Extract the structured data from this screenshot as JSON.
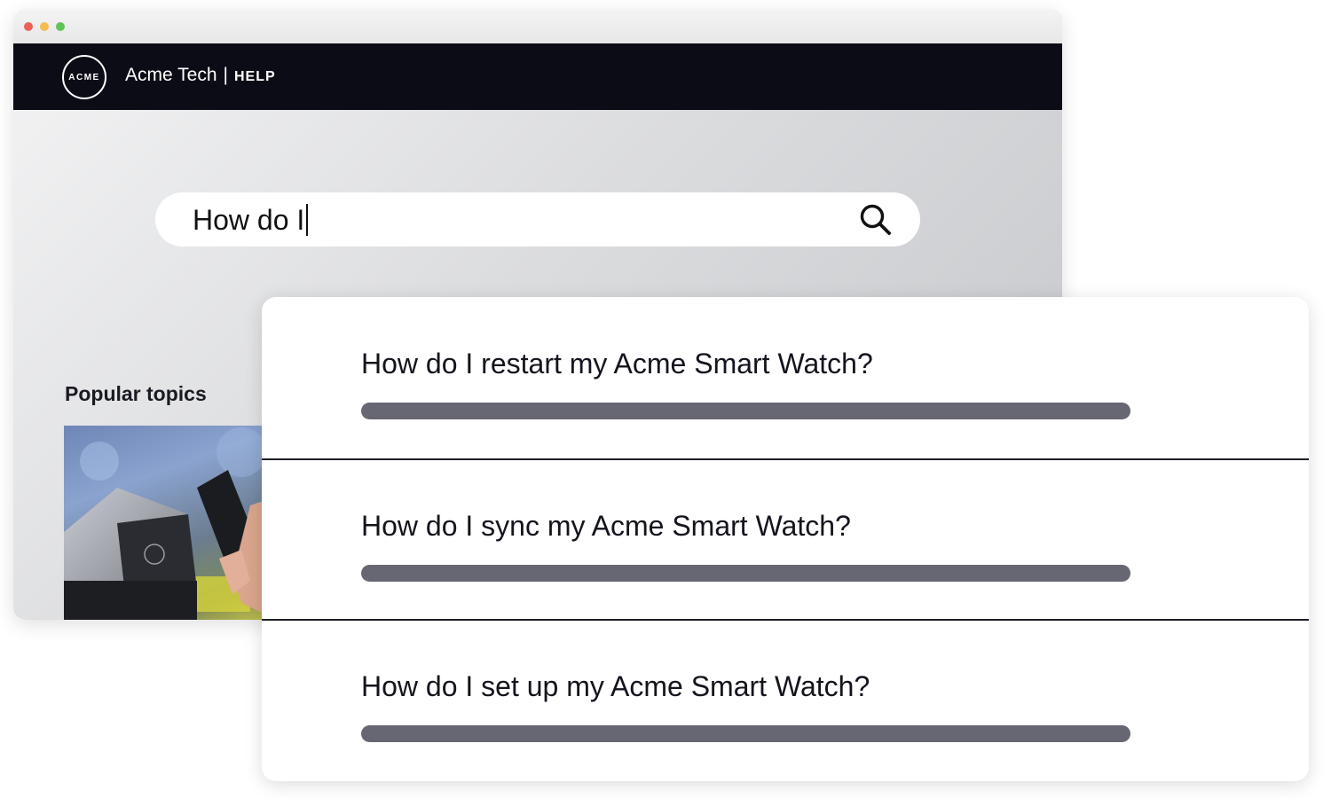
{
  "header": {
    "logo_text": "ACME",
    "brand_name": "Acme Tech",
    "separator": "|",
    "section": "HELP"
  },
  "search": {
    "value": "How do I",
    "icon": "search-icon"
  },
  "popular": {
    "title": "Popular topics"
  },
  "suggestions": [
    {
      "text": "How do I restart my Acme Smart Watch?"
    },
    {
      "text": "How do I sync my Acme Smart Watch?"
    },
    {
      "text": "How do I set up my Acme Smart Watch?"
    }
  ],
  "colors": {
    "navbar": "#0c0c16",
    "placeholder_bar": "#676773"
  }
}
